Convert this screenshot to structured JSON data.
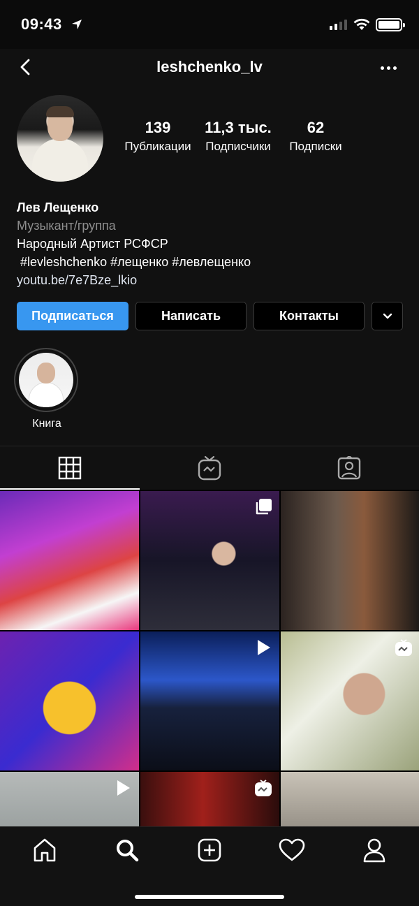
{
  "status_bar": {
    "time": "09:43"
  },
  "header": {
    "username": "leshchenko_lv"
  },
  "profile": {
    "stats": [
      {
        "value": "139",
        "label": "Публикации"
      },
      {
        "value": "11,3 тыс.",
        "label": "Подписчики"
      },
      {
        "value": "62",
        "label": "Подписки"
      }
    ],
    "name": "Лев Лещенко",
    "category": "Музыкант/группа",
    "bio_line": "Народный Артист РСФСР",
    "hashtags": " #levleshchenko #лещенко #левлещенко",
    "link": "youtu.be/7e7Bze_lkio"
  },
  "actions": {
    "follow": "Подписаться",
    "message": "Написать",
    "contacts": "Контакты"
  },
  "highlights": [
    {
      "label": "Книга"
    }
  ],
  "tabs": [
    "grid-icon",
    "igtv-icon",
    "tagged-icon"
  ],
  "grid": [
    {
      "badge": ""
    },
    {
      "badge": "carousel-icon"
    },
    {
      "badge": ""
    },
    {
      "badge": ""
    },
    {
      "badge": "video-icon"
    },
    {
      "badge": "igtv-icon"
    },
    {
      "badge": "video-icon"
    },
    {
      "badge": "igtv-icon"
    },
    {
      "badge": ""
    }
  ],
  "bottom_nav": [
    "home-icon",
    "search-icon",
    "add-post-icon",
    "activity-heart-icon",
    "profile-icon"
  ],
  "colors": {
    "follow_button": "#3897f0",
    "background": "#000000",
    "secondary_text": "#8e8e8e"
  }
}
